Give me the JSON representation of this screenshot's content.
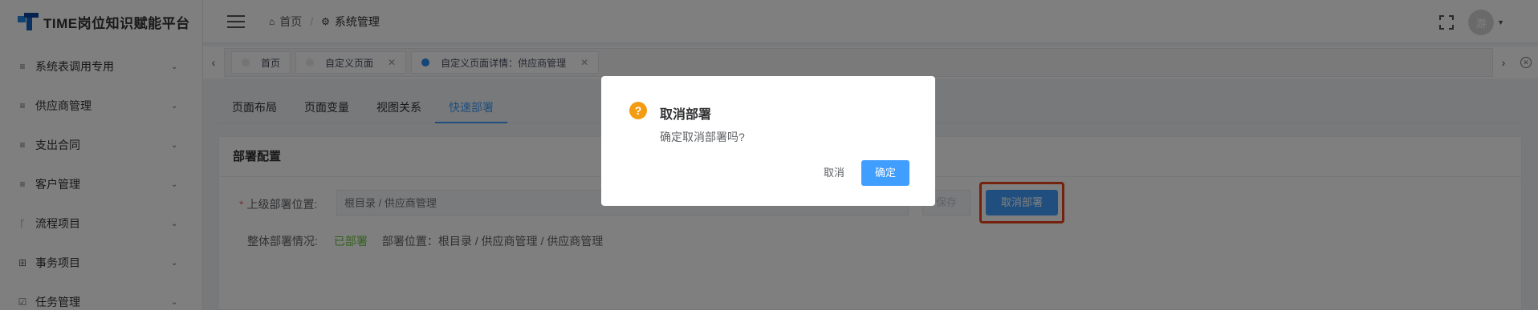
{
  "app": {
    "title": "TIME岗位知识赋能平台"
  },
  "sidebar": {
    "items": [
      {
        "label": "系统表调用专用",
        "icon": "list-icon"
      },
      {
        "label": "供应商管理",
        "icon": "list-icon"
      },
      {
        "label": "支出合同",
        "icon": "list-icon"
      },
      {
        "label": "客户管理",
        "icon": "list-icon"
      },
      {
        "label": "流程项目",
        "icon": "branch-icon"
      },
      {
        "label": "事务项目",
        "icon": "grid-icon"
      },
      {
        "label": "任务管理",
        "icon": "checkbox-icon"
      }
    ]
  },
  "header": {
    "breadcrumb": {
      "home": "首页",
      "sep": "/",
      "current": "系统管理"
    },
    "avatar_text": "游"
  },
  "tags": [
    {
      "label": "首页",
      "closable": false,
      "active": false
    },
    {
      "label": "自定义页面",
      "closable": true,
      "active": false
    },
    {
      "label": "自定义页面详情：供应商管理",
      "closable": true,
      "active": true
    }
  ],
  "subtabs": [
    {
      "label": "页面布局"
    },
    {
      "label": "页面变量"
    },
    {
      "label": "视图关系"
    },
    {
      "label": "快速部署"
    }
  ],
  "deploy": {
    "card_title": "部署配置",
    "location_label": "上级部署位置:",
    "location_placeholder": "根目录 / 供应商管理",
    "save_label": "保存",
    "cancel_deploy_label": "取消部署",
    "overall_label": "整体部署情况:",
    "status": "已部署",
    "position": "部署位置：根目录 / 供应商管理 / 供应商管理"
  },
  "dialog": {
    "icon": "?",
    "title": "取消部署",
    "message": "确定取消部署吗?",
    "cancel_label": "取消",
    "confirm_label": "确定"
  },
  "colors": {
    "primary": "#409eff",
    "highlight": "#e8451a",
    "warning": "#f39c12",
    "success": "#67c23a"
  }
}
